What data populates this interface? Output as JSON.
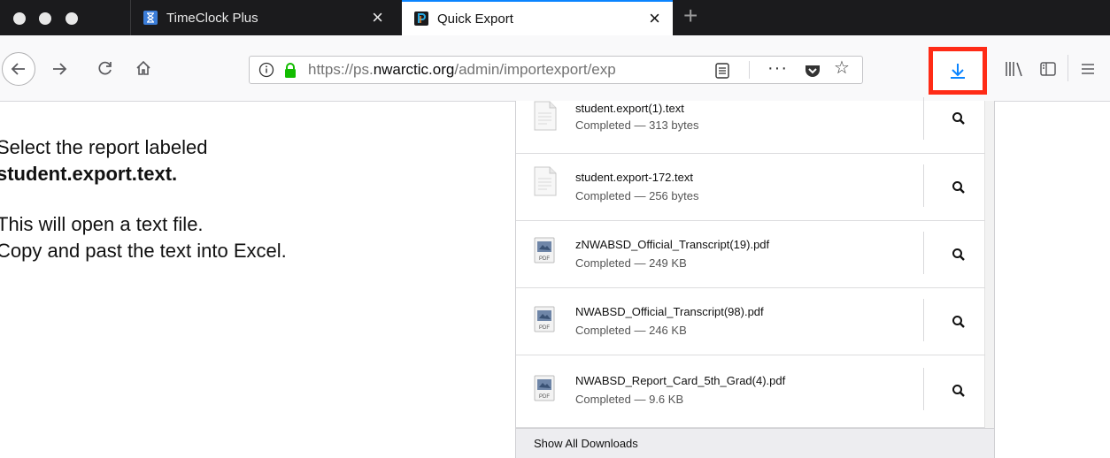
{
  "tabs": [
    {
      "title": "TimeClock Plus",
      "icon": "hourglass-icon",
      "active": false
    },
    {
      "title": "Quick Export",
      "icon": "powerschool-icon",
      "active": true
    }
  ],
  "toolbar": {
    "url_prefix": "https://ps.",
    "url_domain": "nwarctic.org",
    "url_path": "/admin/importexport/exp",
    "more_label": "···"
  },
  "instructions": {
    "line1": "Select the report labeled",
    "line2": "student.export.text.",
    "line3": "This will open a text file.",
    "line4": "Copy and past the text into Excel."
  },
  "downloads": [
    {
      "name": "student.export(1).text",
      "status": "Completed — 313 bytes",
      "type": "text"
    },
    {
      "name": "student.export-172.text",
      "status": "Completed — 256 bytes",
      "type": "text"
    },
    {
      "name": "zNWABSD_Official_Transcript(19).pdf",
      "status": "Completed — 249 KB",
      "type": "pdf"
    },
    {
      "name": "NWABSD_Official_Transcript(98).pdf",
      "status": "Completed — 246 KB",
      "type": "pdf"
    },
    {
      "name": "NWABSD_Report_Card_5th_Grad(4).pdf",
      "status": "Completed — 9.6 KB",
      "type": "pdf"
    }
  ],
  "footer": {
    "show_all": "Show All Downloads"
  },
  "colors": {
    "accent": "#0a84ff",
    "highlight": "#ff2b16",
    "tab_bar": "#1b1b1d"
  }
}
